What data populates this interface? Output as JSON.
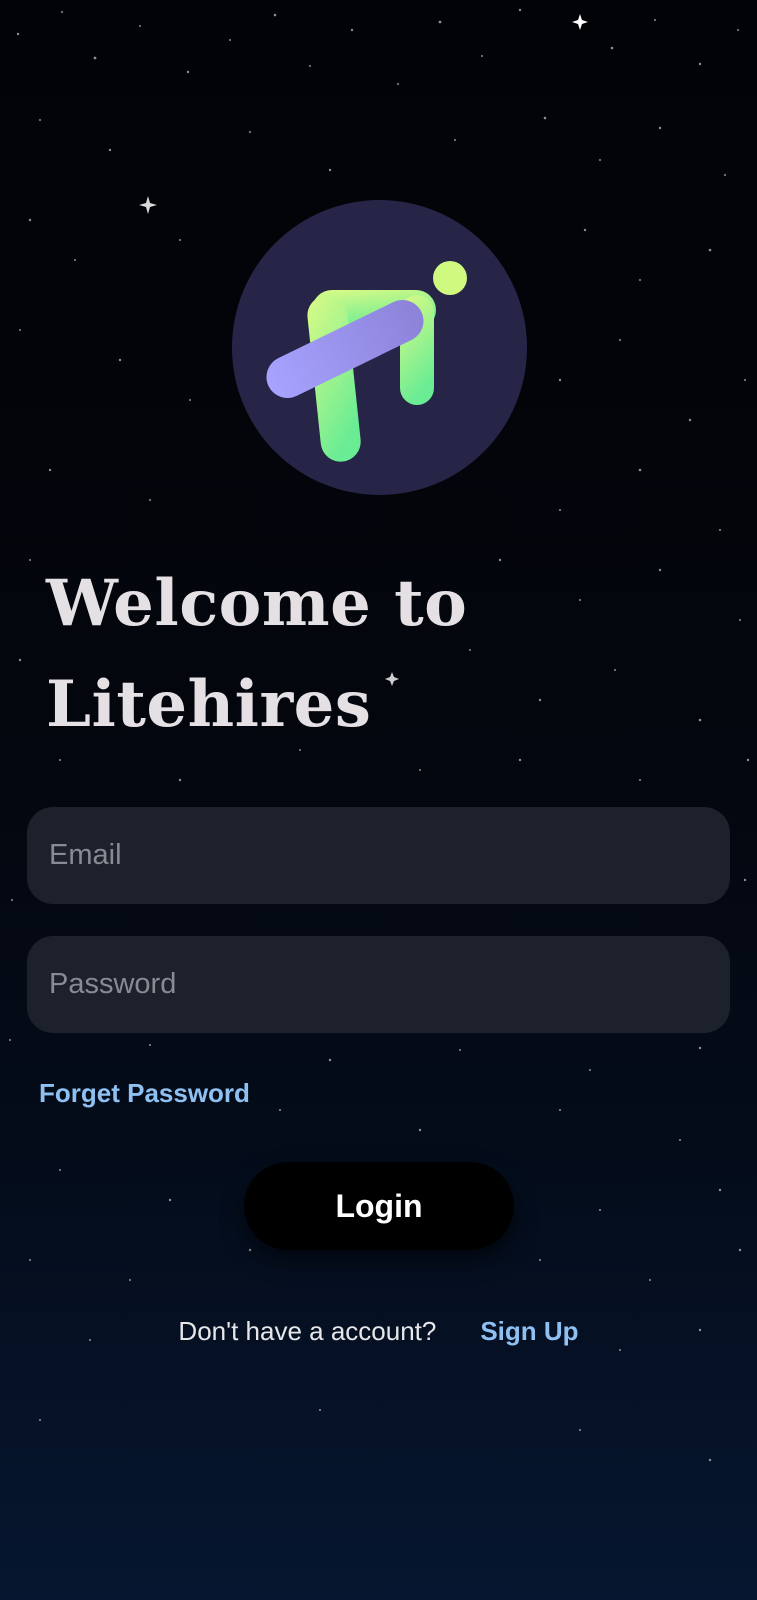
{
  "welcome": {
    "line1": "Welcome to",
    "line2": "Litehires"
  },
  "login_form": {
    "email_placeholder": "Email",
    "password_placeholder": "Password",
    "forgot_password_label": "Forget Password",
    "login_label": "Login"
  },
  "signup": {
    "prompt": "Don't have a account?",
    "link_label": "Sign Up"
  },
  "theme": {
    "background_top": "#020306",
    "background_bottom": "#061630",
    "logo_circle": "#262548",
    "logo_green": "#7df09a",
    "logo_lime": "#d8fb86",
    "logo_violet": "#9f9cff",
    "field_background": "#1c212b",
    "link_color": "#8fc0f2",
    "button_background": "#000000"
  },
  "icons": {
    "logo": "litehires-logo-icon"
  }
}
